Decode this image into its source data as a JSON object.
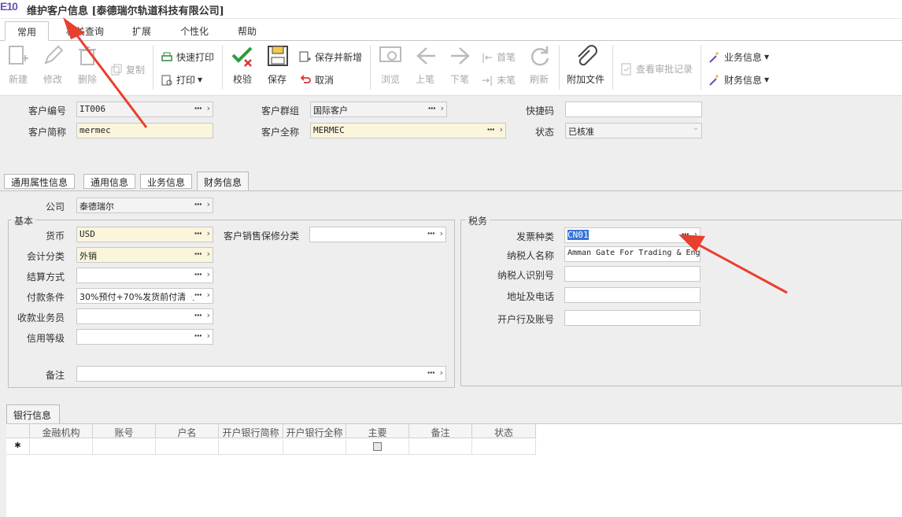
{
  "app": {
    "logo": "E10",
    "title": "维护客户信息 [泰德瑞尔轨道科技有限公司]"
  },
  "ribbon_tabs": [
    "常用",
    "相关查询",
    "扩展",
    "个性化",
    "帮助"
  ],
  "toolbar": {
    "new": "新建",
    "edit": "修改",
    "delete": "删除",
    "copy": "复制",
    "quick_print": "快速打印",
    "print": "打印",
    "verify": "校验",
    "save": "保存",
    "save_new": "保存并新增",
    "cancel": "取消",
    "browse": "浏览",
    "prev": "上笔",
    "next": "下笔",
    "first": "首笔",
    "last": "末笔",
    "refresh": "刷新",
    "attach": "附加文件",
    "approval": "查看审批记录",
    "biz_info": "业务信息",
    "fin_info": "财务信息"
  },
  "header": {
    "customer_code_label": "客户编号",
    "customer_code": "IT006",
    "customer_short_label": "客户简称",
    "customer_short": "mermec",
    "customer_group_label": "客户群组",
    "customer_group": "国际客户",
    "customer_full_label": "客户全称",
    "customer_full": "MERMEC",
    "quick_code_label": "快捷码",
    "quick_code": "",
    "status_label": "状态",
    "status": "已核准"
  },
  "inner_tabs": [
    "通用属性信息",
    "通用信息",
    "业务信息",
    "财务信息"
  ],
  "finance": {
    "company_label": "公司",
    "company": "泰德瑞尔",
    "basic_title": "基本",
    "currency_label": "货币",
    "currency": "USD",
    "accounting_label": "会计分类",
    "accounting": "外销",
    "settle_label": "结算方式",
    "settle": "",
    "payment_label": "付款条件",
    "payment": "30%预付+70%发货前付清（",
    "collector_label": "收款业务员",
    "collector": "",
    "credit_label": "信用等级",
    "credit": "",
    "warranty_label": "客户销售保修分类",
    "warranty": "",
    "remark_label": "备注",
    "remark": ""
  },
  "tax": {
    "title": "税务",
    "invoice_type_label": "发票种类",
    "invoice_type": "CN01",
    "taxpayer_name_label": "纳税人名称",
    "taxpayer_name": "Amman Gate For Trading & Eng",
    "taxpayer_id_label": "纳税人识别号",
    "taxpayer_id": "",
    "address_phone_label": "地址及电话",
    "address_phone": "",
    "bank_account_label": "开户行及账号",
    "bank_account": ""
  },
  "bank": {
    "tab_label": "银行信息",
    "columns": [
      "金融机构",
      "账号",
      "户名",
      "开户银行简称",
      "开户银行全称",
      "主要",
      "备注",
      "状态"
    ],
    "new_row_marker": "✱"
  },
  "colors": {
    "arrow": "#e8402e",
    "selection": "#3875d7",
    "required_bg": "#fbf5dc"
  }
}
